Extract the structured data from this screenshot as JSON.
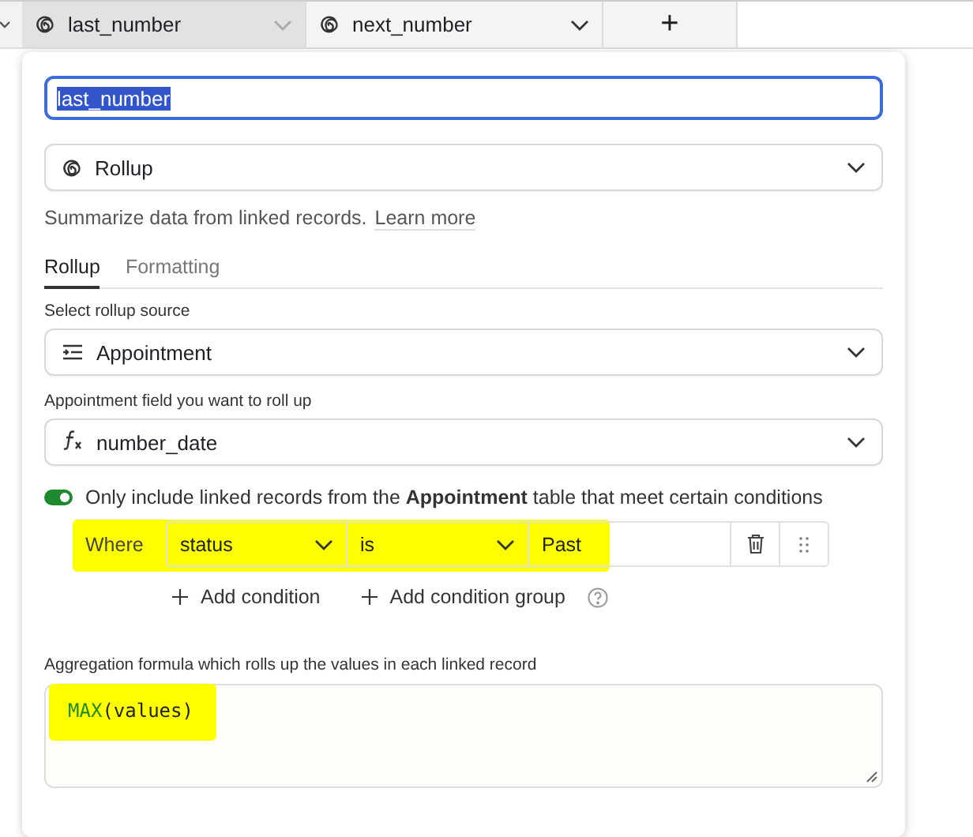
{
  "header": {
    "columns": [
      {
        "name": "last_number",
        "selected": true
      },
      {
        "name": "next_number",
        "selected": false
      }
    ],
    "add_column": "+"
  },
  "popover": {
    "name_value": "last_number",
    "name_text_selected": true,
    "field_type": "Rollup",
    "description": "Summarize data from linked records.",
    "learn_more": "Learn more",
    "tabs": [
      {
        "label": "Rollup",
        "selected": true
      },
      {
        "label": "Formatting",
        "selected": false
      }
    ],
    "source_label": "Select rollup source",
    "source": "Appointment",
    "field_label": "Appointment field you want to roll up",
    "field": "number_date",
    "filter": {
      "on": true,
      "text": "Only include linked records from the **Appointment** table that meet certain conditions"
    },
    "conditions": [
      {
        "where": "Where",
        "field": "status",
        "operator": "is",
        "value": "Past",
        "highlighted": true
      }
    ],
    "add_condition": "Add condition",
    "add_group": "Add condition group",
    "formula_label": "Aggregation formula which rolls up the values in each linked record",
    "formula": {
      "highlighted": true,
      "tokens": [
        {
          "text": "MAX",
          "kind": "function"
        },
        {
          "text": "(values)",
          "kind": "plain"
        }
      ]
    }
  }
}
